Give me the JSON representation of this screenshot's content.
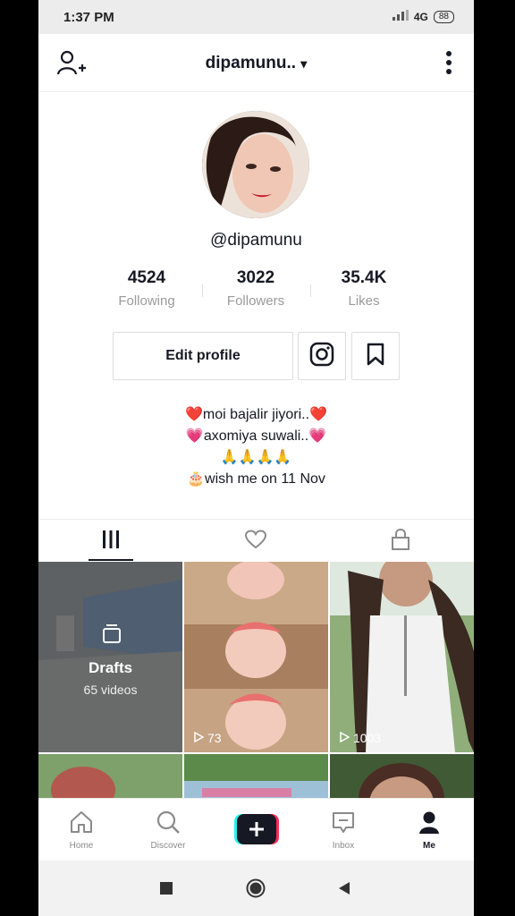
{
  "status": {
    "time": "1:37 PM",
    "network": "4G",
    "battery": "88"
  },
  "header": {
    "username": "dipamunu..",
    "dropdown": "▾"
  },
  "profile": {
    "handle": "@dipamunu"
  },
  "stats": [
    {
      "value": "4524",
      "label": "Following"
    },
    {
      "value": "3022",
      "label": "Followers"
    },
    {
      "value": "35.4K",
      "label": "Likes"
    }
  ],
  "actions": {
    "edit_profile": "Edit profile"
  },
  "bio": {
    "line1": "❤️moi bajalir jiyori..❤️",
    "line2": "💗axomiya suwali..💗",
    "line3": "🙏🙏🙏🙏",
    "line4": "🎂wish me on 11 Nov"
  },
  "grid": {
    "drafts_title": "Drafts",
    "drafts_count": "65 videos",
    "video2_views": "73",
    "video3_views": "1003"
  },
  "nav": {
    "home": "Home",
    "discover": "Discover",
    "inbox": "Inbox",
    "me": "Me"
  },
  "colors": {
    "accent_red": "#fe2c55",
    "accent_cyan": "#25f4ee",
    "text": "#161823"
  }
}
